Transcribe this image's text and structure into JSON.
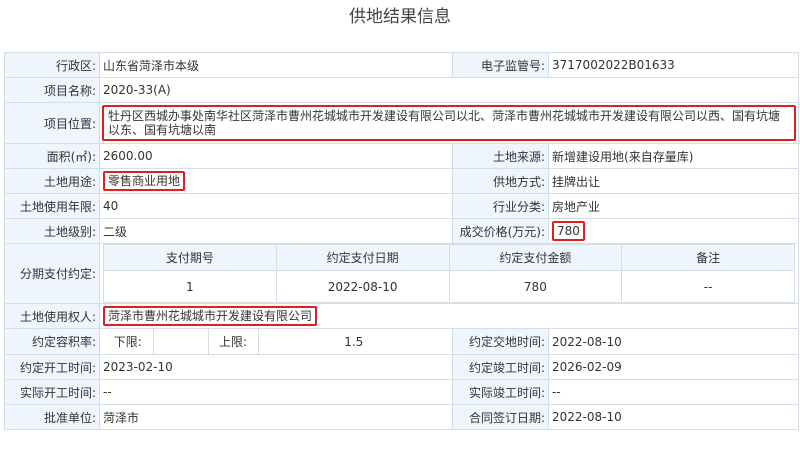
{
  "title": "供地结果信息",
  "fields": {
    "district_label": "行政区:",
    "district_value": "山东省菏泽市本级",
    "supervision_label": "电子监管号:",
    "supervision_value": "3717002022B01633",
    "project_name_label": "项目名称:",
    "project_name_value": "2020-33(A)",
    "location_label": "项目位置:",
    "location_value": "牡丹区西城办事处南华社区菏泽市曹州花城城市开发建设有限公司以北、菏泽市曹州花城城市开发建设有限公司以西、国有坑塘以东、国有坑塘以南",
    "area_label": "面积(㎡):",
    "area_value": "2600.00",
    "land_source_label": "土地来源:",
    "land_source_value": "新增建设用地(来自存量库)",
    "land_use_label": "土地用途:",
    "land_use_value": "零售商业用地",
    "supply_method_label": "供地方式:",
    "supply_method_value": "挂牌出让",
    "use_years_label": "土地使用年限:",
    "use_years_value": "40",
    "industry_label": "行业分类:",
    "industry_value": "房地产业",
    "land_grade_label": "土地级别:",
    "land_grade_value": "二级",
    "price_label": "成交价格(万元):",
    "price_value": "780",
    "installment_label": "分期支付约定:",
    "user_label": "土地使用权人:",
    "user_value": "菏泽市曹州花城城市开发建设有限公司",
    "plot_ratio_label": "约定容积率:",
    "lower_label": "下限:",
    "lower_value": "",
    "upper_label": "上限:",
    "upper_value": "1.5",
    "handover_label": "约定交地时间:",
    "handover_value": "2022-08-10",
    "start_label": "约定开工时间:",
    "start_value": "2023-02-10",
    "complete_label": "约定竣工时间:",
    "complete_value": "2026-02-09",
    "actual_start_label": "实际开工时间:",
    "actual_start_value": "--",
    "actual_complete_label": "实际竣工时间:",
    "actual_complete_value": "--",
    "approval_label": "批准单位:",
    "approval_value": "菏泽市",
    "contract_date_label": "合同签订日期:",
    "contract_date_value": "2022-08-10"
  },
  "installments": {
    "headers": [
      "支付期号",
      "约定支付日期",
      "约定支付金额",
      "备注"
    ],
    "rows": [
      [
        "1",
        "2022-08-10",
        "780",
        "--"
      ]
    ]
  },
  "colors": {
    "label_bg": "#eef5fc",
    "border": "#d5dde6",
    "highlight": "#e02020"
  }
}
